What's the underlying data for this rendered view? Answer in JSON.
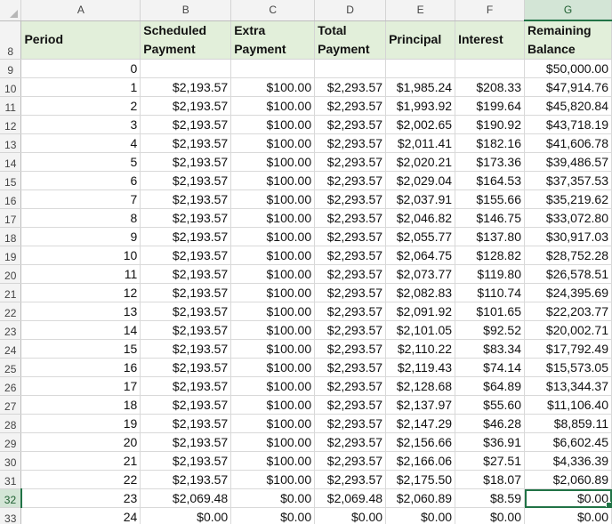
{
  "columns": [
    "A",
    "B",
    "C",
    "D",
    "E",
    "F",
    "G"
  ],
  "selected_column": "G",
  "header_row": {
    "row_number": "8",
    "cells": [
      "Period",
      "Scheduled Payment",
      "Extra Payment",
      "Total Payment",
      "Principal",
      "Interest",
      "Remaining Balance"
    ]
  },
  "selected_row": "32",
  "rows": [
    {
      "n": "9",
      "cells": [
        "0",
        "",
        "",
        "",
        "",
        "",
        "$50,000.00"
      ]
    },
    {
      "n": "10",
      "cells": [
        "1",
        "$2,193.57",
        "$100.00",
        "$2,293.57",
        "$1,985.24",
        "$208.33",
        "$47,914.76"
      ]
    },
    {
      "n": "11",
      "cells": [
        "2",
        "$2,193.57",
        "$100.00",
        "$2,293.57",
        "$1,993.92",
        "$199.64",
        "$45,820.84"
      ]
    },
    {
      "n": "12",
      "cells": [
        "3",
        "$2,193.57",
        "$100.00",
        "$2,293.57",
        "$2,002.65",
        "$190.92",
        "$43,718.19"
      ]
    },
    {
      "n": "13",
      "cells": [
        "4",
        "$2,193.57",
        "$100.00",
        "$2,293.57",
        "$2,011.41",
        "$182.16",
        "$41,606.78"
      ]
    },
    {
      "n": "14",
      "cells": [
        "5",
        "$2,193.57",
        "$100.00",
        "$2,293.57",
        "$2,020.21",
        "$173.36",
        "$39,486.57"
      ]
    },
    {
      "n": "15",
      "cells": [
        "6",
        "$2,193.57",
        "$100.00",
        "$2,293.57",
        "$2,029.04",
        "$164.53",
        "$37,357.53"
      ]
    },
    {
      "n": "16",
      "cells": [
        "7",
        "$2,193.57",
        "$100.00",
        "$2,293.57",
        "$2,037.91",
        "$155.66",
        "$35,219.62"
      ]
    },
    {
      "n": "17",
      "cells": [
        "8",
        "$2,193.57",
        "$100.00",
        "$2,293.57",
        "$2,046.82",
        "$146.75",
        "$33,072.80"
      ]
    },
    {
      "n": "18",
      "cells": [
        "9",
        "$2,193.57",
        "$100.00",
        "$2,293.57",
        "$2,055.77",
        "$137.80",
        "$30,917.03"
      ]
    },
    {
      "n": "19",
      "cells": [
        "10",
        "$2,193.57",
        "$100.00",
        "$2,293.57",
        "$2,064.75",
        "$128.82",
        "$28,752.28"
      ]
    },
    {
      "n": "20",
      "cells": [
        "11",
        "$2,193.57",
        "$100.00",
        "$2,293.57",
        "$2,073.77",
        "$119.80",
        "$26,578.51"
      ]
    },
    {
      "n": "21",
      "cells": [
        "12",
        "$2,193.57",
        "$100.00",
        "$2,293.57",
        "$2,082.83",
        "$110.74",
        "$24,395.69"
      ]
    },
    {
      "n": "22",
      "cells": [
        "13",
        "$2,193.57",
        "$100.00",
        "$2,293.57",
        "$2,091.92",
        "$101.65",
        "$22,203.77"
      ]
    },
    {
      "n": "23",
      "cells": [
        "14",
        "$2,193.57",
        "$100.00",
        "$2,293.57",
        "$2,101.05",
        "$92.52",
        "$20,002.71"
      ]
    },
    {
      "n": "24",
      "cells": [
        "15",
        "$2,193.57",
        "$100.00",
        "$2,293.57",
        "$2,110.22",
        "$83.34",
        "$17,792.49"
      ]
    },
    {
      "n": "25",
      "cells": [
        "16",
        "$2,193.57",
        "$100.00",
        "$2,293.57",
        "$2,119.43",
        "$74.14",
        "$15,573.05"
      ]
    },
    {
      "n": "26",
      "cells": [
        "17",
        "$2,193.57",
        "$100.00",
        "$2,293.57",
        "$2,128.68",
        "$64.89",
        "$13,344.37"
      ]
    },
    {
      "n": "27",
      "cells": [
        "18",
        "$2,193.57",
        "$100.00",
        "$2,293.57",
        "$2,137.97",
        "$55.60",
        "$11,106.40"
      ]
    },
    {
      "n": "28",
      "cells": [
        "19",
        "$2,193.57",
        "$100.00",
        "$2,293.57",
        "$2,147.29",
        "$46.28",
        "$8,859.11"
      ]
    },
    {
      "n": "29",
      "cells": [
        "20",
        "$2,193.57",
        "$100.00",
        "$2,293.57",
        "$2,156.66",
        "$36.91",
        "$6,602.45"
      ]
    },
    {
      "n": "30",
      "cells": [
        "21",
        "$2,193.57",
        "$100.00",
        "$2,293.57",
        "$2,166.06",
        "$27.51",
        "$4,336.39"
      ]
    },
    {
      "n": "31",
      "cells": [
        "22",
        "$2,193.57",
        "$100.00",
        "$2,293.57",
        "$2,175.50",
        "$18.07",
        "$2,060.89"
      ]
    },
    {
      "n": "32",
      "cells": [
        "23",
        "$2,069.48",
        "$0.00",
        "$2,069.48",
        "$2,060.89",
        "$8.59",
        "$0.00"
      ]
    },
    {
      "n": "33",
      "cells": [
        "24",
        "$0.00",
        "$0.00",
        "$0.00",
        "$0.00",
        "$0.00",
        "$0.00"
      ]
    }
  ]
}
